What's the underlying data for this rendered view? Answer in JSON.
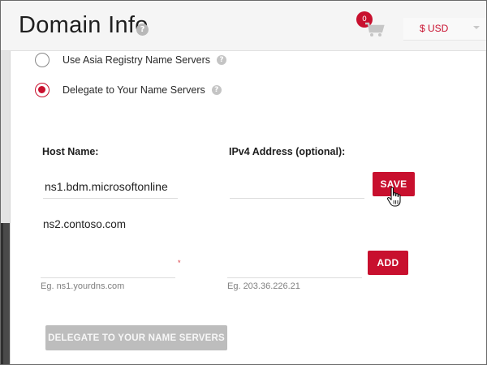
{
  "header": {
    "title": "Domain Info",
    "title_help_icon": "question-circle-icon",
    "cart_icon": "cart-icon",
    "cart_count": "0",
    "currency": "$ USD",
    "currency_caret_icon": "chevron-down-icon"
  },
  "name_server_options": [
    {
      "label": "Use Asia Registry Name Servers",
      "selected": false,
      "help_icon": "question-circle-icon"
    },
    {
      "label": "Delegate to Your Name Servers",
      "selected": true,
      "help_icon": "question-circle-icon"
    }
  ],
  "form": {
    "host_name_label": "Host Name:",
    "ipv4_label": "IPv4 Address (optional):",
    "row1": {
      "host_value": "ns1.bdm.microsoftonline",
      "ipv4_value": "",
      "save_label": "SAVE"
    },
    "row2": {
      "host_value": "ns2.contoso.com"
    },
    "new_row": {
      "host_value": "",
      "host_required_mark": "*",
      "host_hint": "Eg. ns1.yourdns.com",
      "ipv4_value": "",
      "ipv4_hint": "Eg. 203.36.226.21",
      "add_label": "ADD"
    },
    "delegate_button_label": "DELEGATE TO YOUR NAME SERVERS"
  },
  "colors": {
    "accent": "#c8102e",
    "disabled_button": "#bdbdbd",
    "header_bg": "#f5f5f5",
    "hint_text": "#808080"
  }
}
